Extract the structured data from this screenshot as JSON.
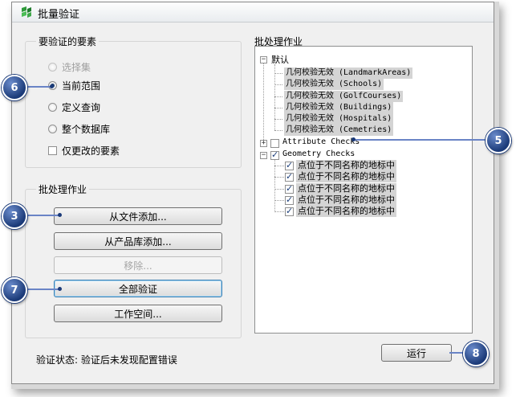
{
  "window": {
    "title": "批量验证"
  },
  "elements_group": {
    "title": "要验证的要素",
    "options": [
      {
        "label": "选择集",
        "state": "disabled"
      },
      {
        "label": "当前范围",
        "state": "selected"
      },
      {
        "label": "定义查询",
        "state": "normal"
      },
      {
        "label": "整个数据库",
        "state": "normal"
      }
    ],
    "changed_only_label": "仅更改的要素"
  },
  "batch_group": {
    "title": "批处理作业",
    "buttons": {
      "add_from_file": "从文件添加...",
      "add_from_library": "从产品库添加...",
      "remove": "移除...",
      "validate_all": "全部验证",
      "workspace": "工作空间..."
    }
  },
  "jobs_panel": {
    "title": "批处理作业",
    "tree": {
      "default_label": "默认",
      "default_items": [
        "几何校验无效 (LandmarkAreas)",
        "几何校验无效 (Schools)",
        "几何校验无效 (GolfCourses)",
        "几何校验无效 (Buildings)",
        "几何校验无效 (Hospitals)",
        "几何校验无效 (Cemetries)"
      ],
      "attribute_label": "Attribute Checks",
      "geometry_label": "Geometry Checks",
      "geometry_items": [
        "点位于不同名称的地标中",
        "点位于不同名称的地标中",
        "点位于不同名称的地标中",
        "点位于不同名称的地标中",
        "点位于不同名称的地标中"
      ]
    }
  },
  "status": {
    "text": "验证状态:  验证后未发现配置错误"
  },
  "run_button": "运行",
  "callouts": {
    "c3": "3",
    "c5": "5",
    "c6": "6",
    "c7": "7",
    "c8": "8"
  },
  "colors": {
    "callout": "#1b3a78",
    "callout_line": "#6a84c6",
    "tree_highlight": "#d4d4d4"
  }
}
